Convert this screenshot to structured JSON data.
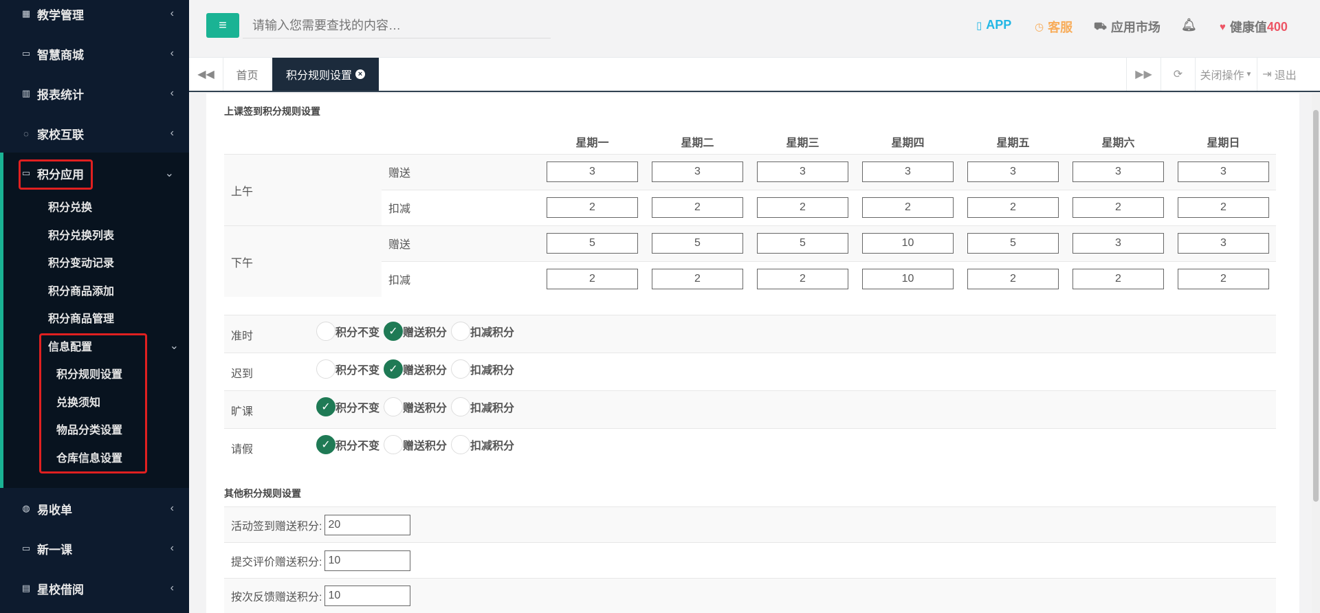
{
  "sidebar": {
    "items": [
      {
        "icon": "calendar-icon",
        "label": "教学管理"
      },
      {
        "icon": "inbox-icon",
        "label": "智慧商城"
      },
      {
        "icon": "bar-chart-icon",
        "label": "报表统计"
      },
      {
        "icon": "chat-icon",
        "label": "家校互联"
      },
      {
        "icon": "inbox-icon",
        "label": "积分应用"
      },
      {
        "icon": "user-plus-icon",
        "label": "易收单"
      },
      {
        "icon": "inbox-icon",
        "label": "新一课"
      },
      {
        "icon": "book-icon",
        "label": "星校借阅"
      }
    ],
    "sub_items": [
      "积分兑换",
      "积分兑换列表",
      "积分变动记录",
      "积分商品添加",
      "积分商品管理"
    ],
    "info_config": {
      "label": "信息配置",
      "children": [
        "积分规则设置",
        "兑换须知",
        "物品分类设置",
        "仓库信息设置"
      ]
    }
  },
  "header": {
    "search_placeholder": "请输入您需要查找的内容…",
    "app_label": "APP",
    "service_label": "客服",
    "market_label": "应用市场",
    "health_label": "健康值",
    "health_value": "400",
    "colors": {
      "accent": "#1ab394",
      "app": "#23b7e5",
      "service": "#f8ac59",
      "health": "#ed5565"
    }
  },
  "tabs": {
    "home": "首页",
    "active": "积分规则设置",
    "close_ops": "关闭操作",
    "logout": "退出"
  },
  "checkin": {
    "title": "上课签到积分规则设置",
    "days": [
      "星期一",
      "星期二",
      "星期三",
      "星期四",
      "星期五",
      "星期六",
      "星期日"
    ],
    "morning": {
      "label": "上午",
      "give_label": "赠送",
      "deduct_label": "扣减",
      "give": [
        "3",
        "3",
        "3",
        "3",
        "3",
        "3",
        "3"
      ],
      "deduct": [
        "2",
        "2",
        "2",
        "2",
        "2",
        "2",
        "2"
      ]
    },
    "afternoon": {
      "label": "下午",
      "give_label": "赠送",
      "deduct_label": "扣减",
      "give": [
        "5",
        "5",
        "5",
        "10",
        "5",
        "3",
        "3"
      ],
      "deduct": [
        "2",
        "2",
        "2",
        "10",
        "2",
        "2",
        "2"
      ]
    }
  },
  "attendance": {
    "options": [
      "积分不变",
      "赠送积分",
      "扣减积分"
    ],
    "rows": [
      {
        "label": "准时",
        "selected": 1
      },
      {
        "label": "迟到",
        "selected": 1
      },
      {
        "label": "旷课",
        "selected": 0
      },
      {
        "label": "请假",
        "selected": 0
      }
    ]
  },
  "other": {
    "title": "其他积分规则设置",
    "rows": [
      {
        "label": "活动签到赠送积分:",
        "value": "20"
      },
      {
        "label": "提交评价赠送积分:",
        "value": "10"
      },
      {
        "label": "按次反馈赠送积分:",
        "value": "10"
      }
    ]
  }
}
